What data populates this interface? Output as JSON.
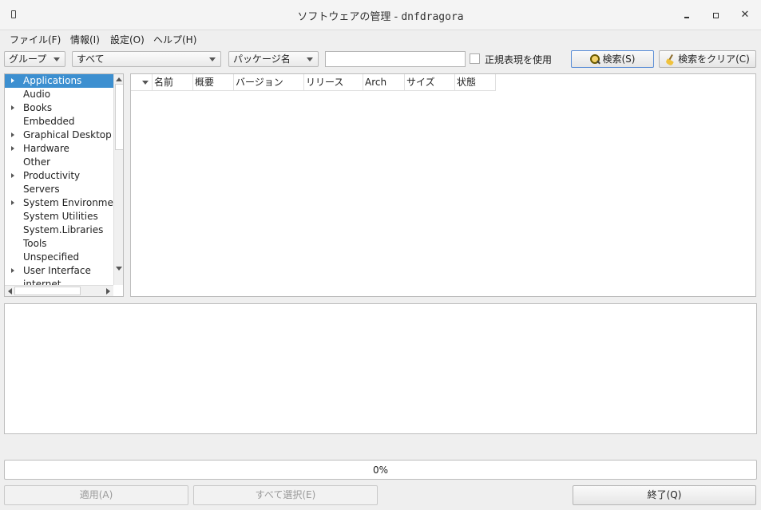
{
  "window": {
    "title": "ソフトウェアの管理",
    "separator": " - ",
    "app_name": "dnfdragora",
    "close_glyph": "✕"
  },
  "menu": [
    "ファイル(F)",
    "情報(I)",
    "設定(O)",
    "ヘルプ(H)"
  ],
  "toolbar": {
    "view_combo": "グループ",
    "filter_combo": "すべて",
    "field_combo": "パッケージ名",
    "search_value": "",
    "regex_label": "正規表現を使用",
    "regex_checked": false,
    "search_button": "検索(S)",
    "clear_button": "検索をクリア(C)"
  },
  "groups": [
    {
      "label": "Applications",
      "expandable": true,
      "selected": true
    },
    {
      "label": "Audio",
      "expandable": false
    },
    {
      "label": "Books",
      "expandable": true
    },
    {
      "label": "Embedded",
      "expandable": false
    },
    {
      "label": "Graphical Desktop",
      "expandable": true
    },
    {
      "label": "Hardware",
      "expandable": true
    },
    {
      "label": "Other",
      "expandable": false
    },
    {
      "label": "Productivity",
      "expandable": true
    },
    {
      "label": "Servers",
      "expandable": false
    },
    {
      "label": "System Environment",
      "expandable": true
    },
    {
      "label": "System Utilities",
      "expandable": false
    },
    {
      "label": "System.Libraries",
      "expandable": false
    },
    {
      "label": "Tools",
      "expandable": false
    },
    {
      "label": "Unspecified",
      "expandable": false
    },
    {
      "label": "User Interface",
      "expandable": true
    },
    {
      "label": "internet",
      "expandable": false
    }
  ],
  "table": {
    "columns": [
      "名前",
      "概要",
      "バージョン",
      "リリース",
      "Arch",
      "サイズ",
      "状態"
    ],
    "rows": []
  },
  "info_text": "",
  "progress": {
    "value": 0,
    "label": "0%"
  },
  "buttons": {
    "apply": "適用(A)",
    "select_all": "すべて選択(E)",
    "quit": "終了(Q)"
  },
  "colors": {
    "selection": "#3c8fd0",
    "focus_border": "#5b8ed6"
  }
}
